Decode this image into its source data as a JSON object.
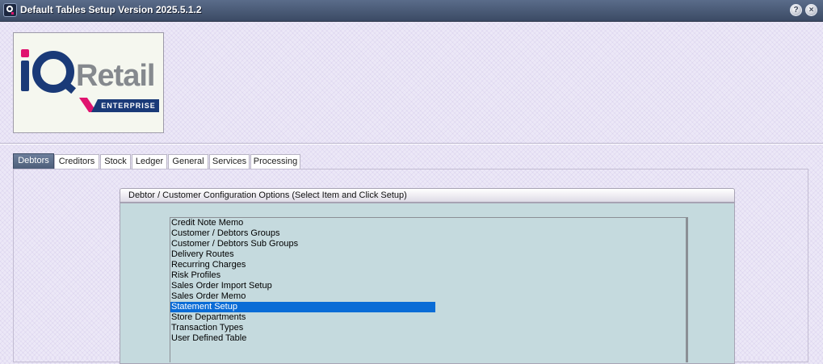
{
  "window": {
    "title": "Default Tables Setup Version 2025.5.1.2",
    "help_label": "?",
    "close_label": "×"
  },
  "logo": {
    "brand_text": "Retail",
    "edition_text": "ENTERPRISE",
    "colors": {
      "navy": "#1a3a78",
      "magenta": "#e0146f",
      "gray": "#85898e"
    }
  },
  "tabs": [
    {
      "label": "Debtors",
      "active": true
    },
    {
      "label": "Creditors",
      "active": false
    },
    {
      "label": "Stock",
      "active": false
    },
    {
      "label": "Ledger",
      "active": false
    },
    {
      "label": "General",
      "active": false
    },
    {
      "label": "Services",
      "active": false
    },
    {
      "label": "Processing",
      "active": false
    }
  ],
  "panel": {
    "title": "Debtor / Customer Configuration Options (Select Item and Click Setup)"
  },
  "list": {
    "items": [
      "Credit Note Memo",
      "Customer / Debtors Groups",
      "Customer / Debtors Sub Groups",
      "Delivery Routes",
      "Recurring Charges",
      "Risk Profiles",
      "Sales Order Import Setup",
      "Sales Order Memo",
      "Statement Setup",
      "Store Departments",
      "Transaction Types",
      "User Defined Table"
    ],
    "selected": "Statement Setup"
  },
  "colors": {
    "selection": "#0a6cd6",
    "list_background": "#c5dade",
    "active_tab": "#5b6b87"
  }
}
